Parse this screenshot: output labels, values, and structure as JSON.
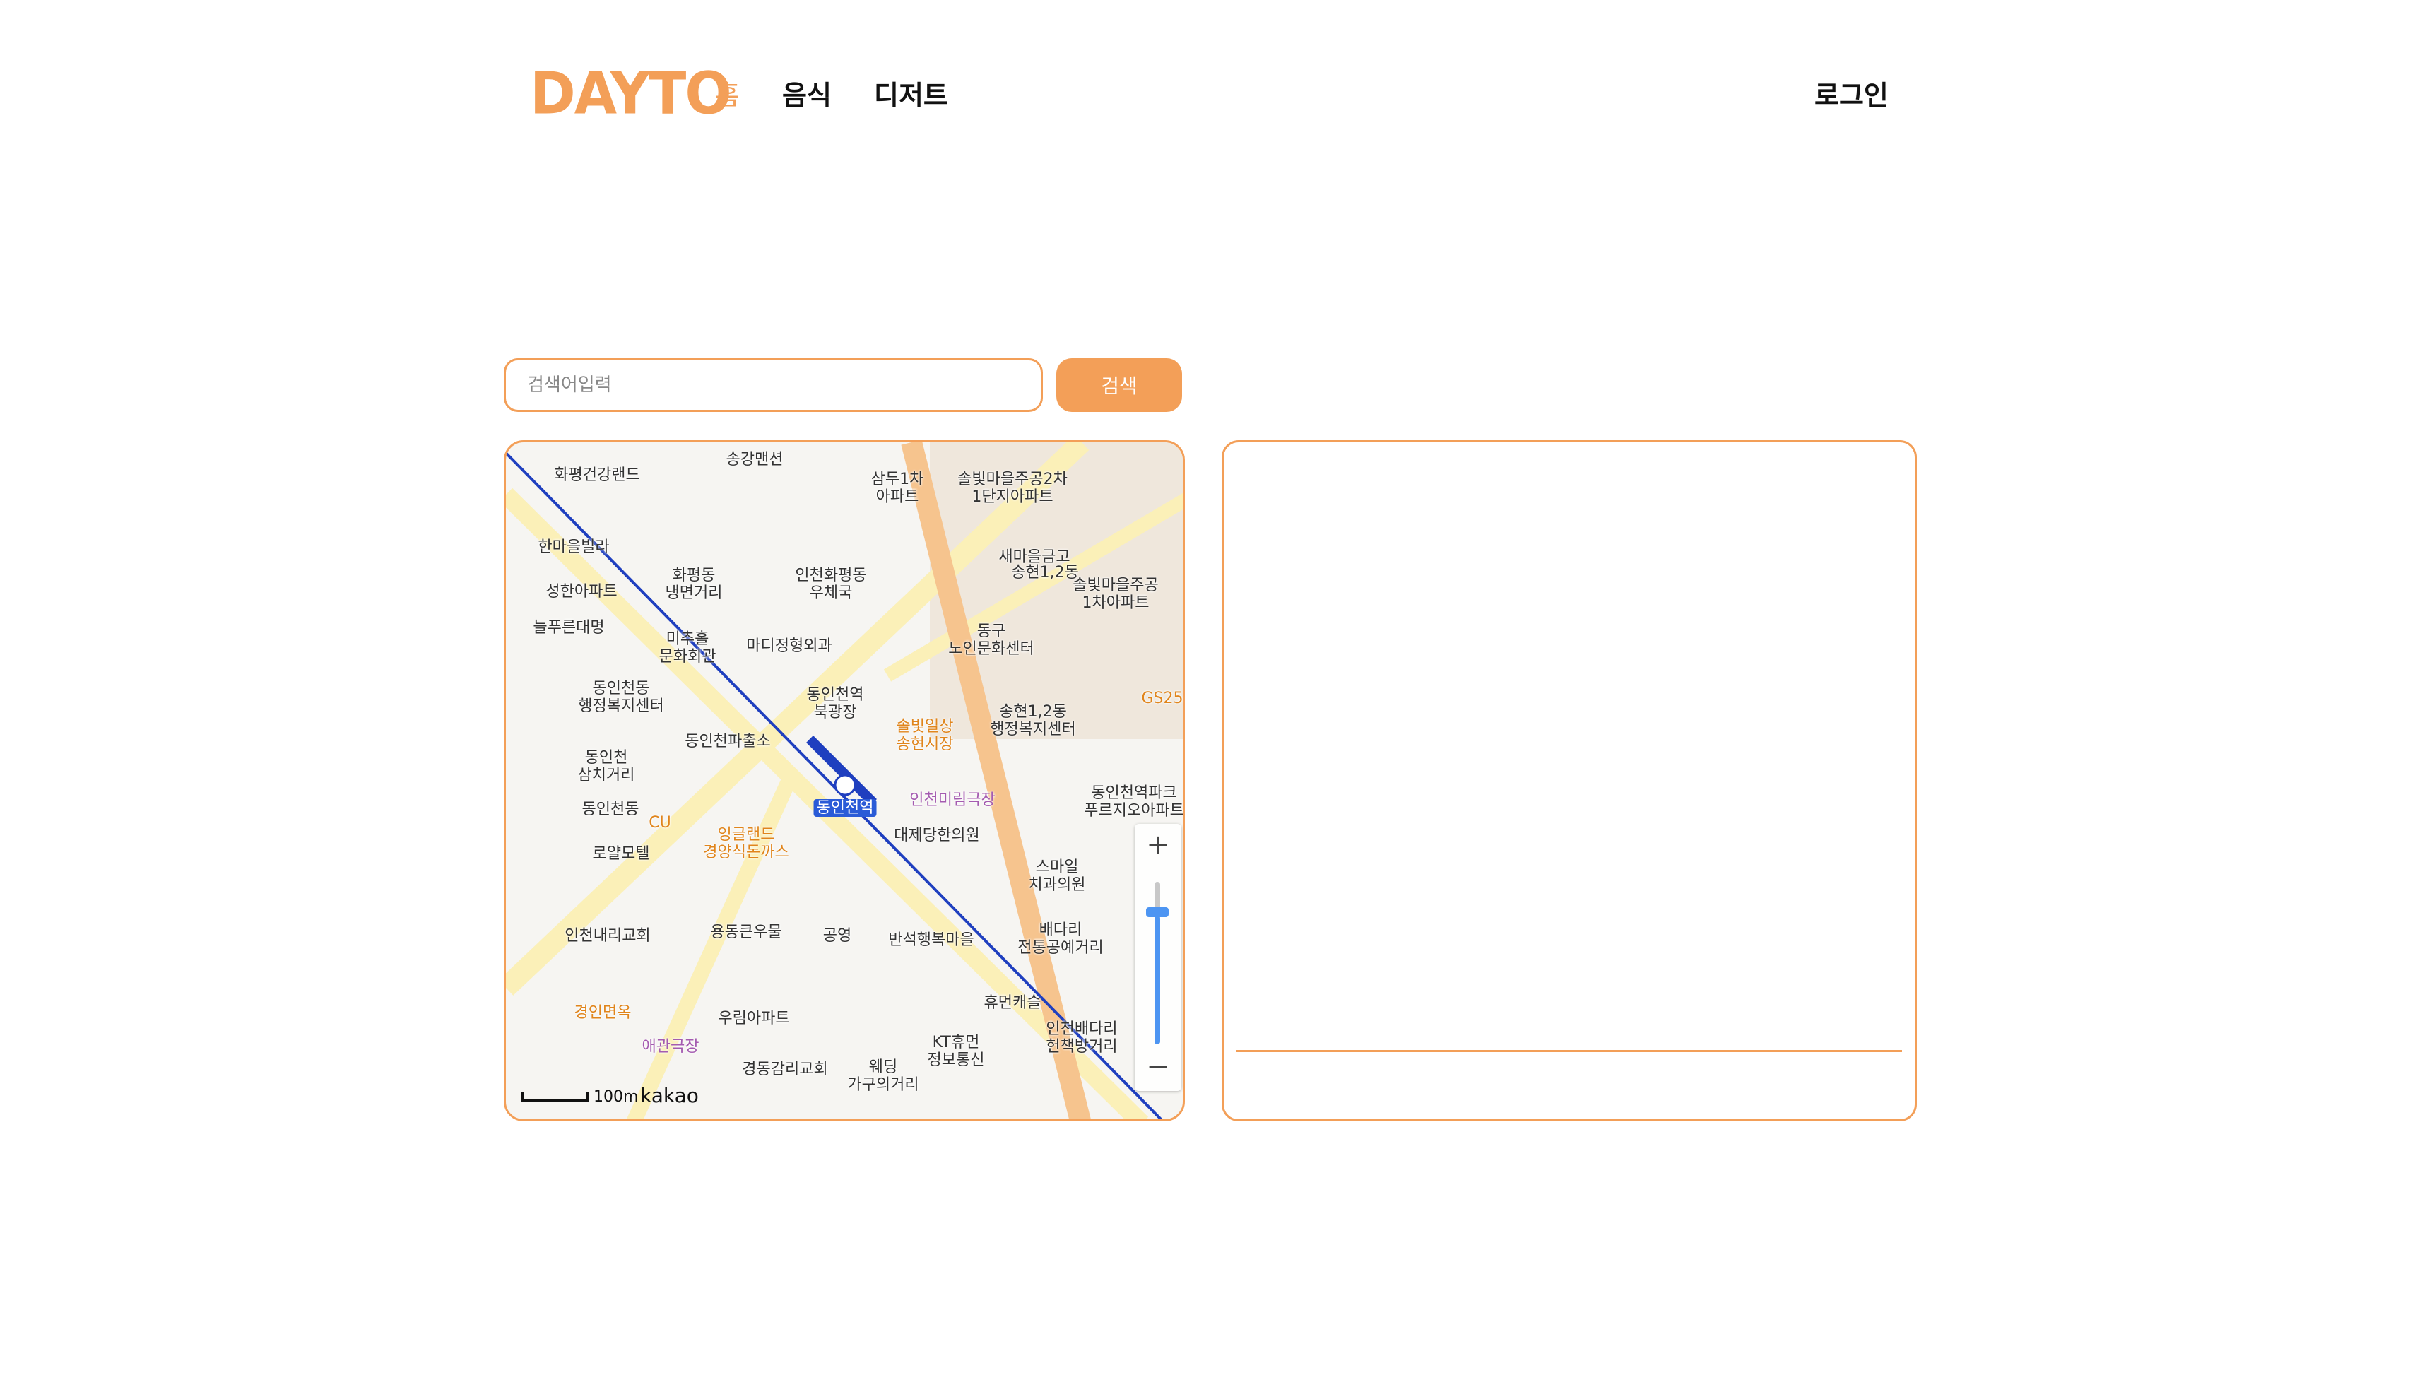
{
  "header": {
    "logo": "DAYTO",
    "nav": [
      {
        "label": "홈",
        "active": true
      },
      {
        "label": "음식"
      },
      {
        "label": "디저트"
      }
    ],
    "login": "로그인"
  },
  "search": {
    "placeholder": "검색어입력",
    "value": "",
    "button": "검색"
  },
  "colors": {
    "accent": "#f39f58",
    "zoom_slider": "#4d95f2",
    "subway_line": "#1f3fbf"
  },
  "map": {
    "labels": [
      "송강맨션",
      "화평건강랜드",
      "삼두1차\n아파트",
      "솔빛마을주공2차\n1단지아파트",
      "한마을빌라",
      "화평동\n냉면거리",
      "인천화평동\n우체국",
      "새마을금고",
      "송현1,2동",
      "솔빛마을주공\n1차아파트",
      "성한아파트",
      "늘푸른대명",
      "미추홀\n문화회관",
      "마디정형외과",
      "동구\n노인문화센터",
      "동인천동\n행정복지센터",
      "동인천역\n북광장",
      "솔빛일상\n송현시장",
      "송현1,2동\n행정복지센터",
      "GS25",
      "동인천파출소",
      "동인천\n삼치거리",
      "인천미림극장",
      "동인천역",
      "동인천동",
      "CU",
      "대제당한의원",
      "동인천역파크\n푸르지오아파트",
      "로얄모텔",
      "잉글랜드\n경양식돈까스",
      "스마일\n치과의원",
      "인천내리교회",
      "용동큰우물",
      "공영",
      "반석행복마을",
      "배다리\n전통공예거리",
      "경인면옥",
      "우림아파트",
      "휴먼캐슬",
      "인천배다리\n헌책방거리",
      "애관극장",
      "KT휴먼\n정보통신",
      "경동감리교회",
      "웨딩\n가구의거리"
    ],
    "zoom_in": "+",
    "zoom_out": "−",
    "zoom_level_fraction": 0.8,
    "scale": "100m",
    "attribution": "kakao"
  }
}
